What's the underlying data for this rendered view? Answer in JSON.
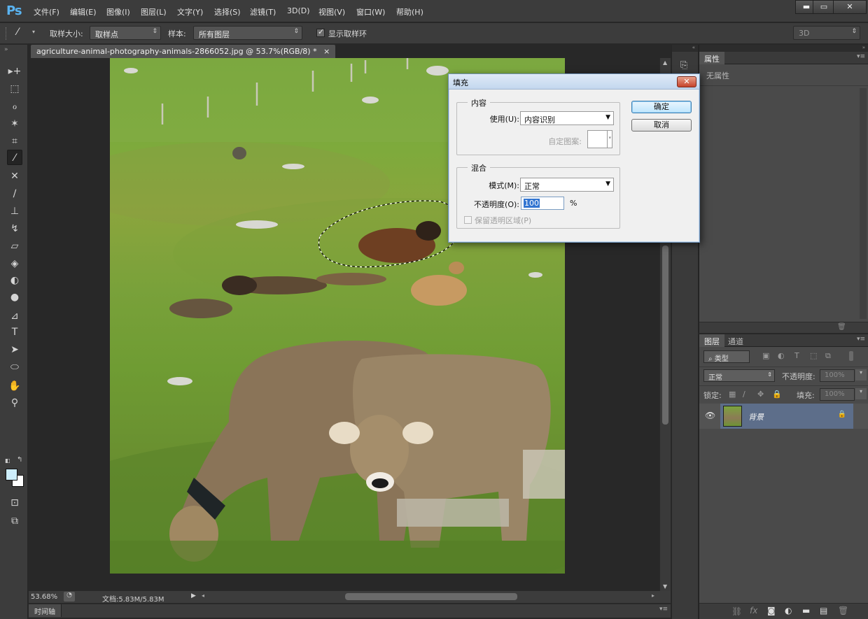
{
  "app": {
    "logo": "Ps"
  },
  "menu": [
    "文件(F)",
    "编辑(E)",
    "图像(I)",
    "图层(L)",
    "文字(Y)",
    "选择(S)",
    "滤镜(T)",
    "3D(D)",
    "视图(V)",
    "窗口(W)",
    "帮助(H)"
  ],
  "window_controls": {
    "minimize": "▬",
    "maximize": "▭",
    "close": "✕"
  },
  "options": {
    "sample_size_label": "取样大小:",
    "sample_size_value": "取样点",
    "sample_label": "样本:",
    "sample_value": "所有图层",
    "show_ring_label": "显示取样环",
    "show_ring_checked": true,
    "workspace": "3D"
  },
  "document": {
    "tab_title": "agriculture-animal-photography-animals-2866052.jpg @ 53.7%(RGB/8) *",
    "tab_close": "×"
  },
  "status": {
    "zoom": "53.68%",
    "doc_info": "文档:5.83M/5.83M"
  },
  "timeline": {
    "label": "时间轴"
  },
  "colors": {
    "foreground": "#cdeefc",
    "background": "#ffffff",
    "accent": "#5ab3f0"
  },
  "properties_panel": {
    "tab": "属性",
    "empty_text": "无属性"
  },
  "layers_panel": {
    "tabs": [
      "图层",
      "通道"
    ],
    "filter_kind": "类型",
    "blend_mode": "正常",
    "opacity_label": "不透明度:",
    "opacity_value": "100%",
    "lock_label": "锁定:",
    "fill_label": "填充:",
    "fill_value": "100%",
    "layers": [
      {
        "name": "背景",
        "visible": true,
        "locked": true
      }
    ]
  },
  "fill_dialog": {
    "title": "填充",
    "close": "✕",
    "content_group": "内容",
    "use_label": "使用(U):",
    "use_value": "内容识别",
    "custom_pattern_label": "自定图案:",
    "blend_group": "混合",
    "mode_label": "模式(M):",
    "mode_value": "正常",
    "opacity_label": "不透明度(O):",
    "opacity_value": "100",
    "percent": "%",
    "preserve_label": "保留透明区域(P)",
    "preserve_checked": false,
    "ok": "确定",
    "cancel": "取消"
  }
}
